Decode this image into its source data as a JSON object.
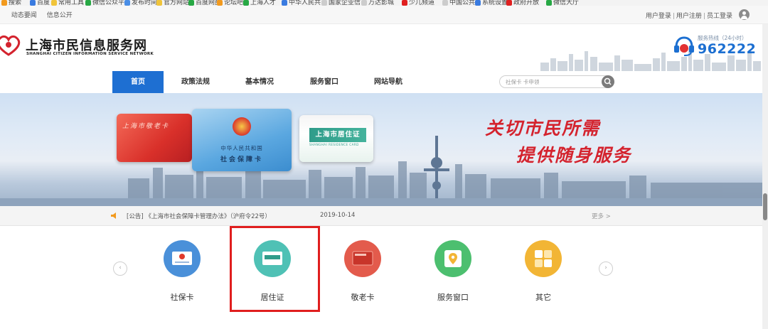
{
  "bookmarks": [
    "搜索",
    "百度",
    "常用工具",
    "微信公众平",
    "发布时间",
    "官方网站",
    "百度网盘",
    "论坛吧",
    "上海人才",
    "中华人民共",
    "国家企业信",
    "万达影城",
    "少儿频道",
    "中国公共",
    "系统设置",
    "政府开放",
    "微信大厅"
  ],
  "topbar": {
    "left_links": [
      "动态要闻",
      "信息公开"
    ],
    "login": "用户登录",
    "register": "用户注册",
    "staff_login": "员工登录",
    "separator": "|"
  },
  "header": {
    "site_name": "上海市民信息服务网",
    "site_name_en": "SHANGHAI CITIZEN INFORMATION SERVICE NETWORK",
    "hotline_label": "服务热线（24小时）",
    "hotline_number": "962222"
  },
  "nav": {
    "items": [
      "首页",
      "政策法规",
      "基本情况",
      "服务窗口",
      "网站导航"
    ],
    "active_index": 0
  },
  "search": {
    "placeholder": "社保卡 卡申领"
  },
  "banner": {
    "card_red_title": "上海市敬老卡",
    "card_blue_line1": "中华人民共和国",
    "card_blue_line2": "社会保障卡",
    "card_green_title": "上海市居住证",
    "card_green_sub": "SHANGHAI RESIDENCE CARD",
    "slogan_line1": "关切市民所需",
    "slogan_line2": "提供随身服务"
  },
  "notice": {
    "text": "[公告]  《上海市社会保障卡管理办法》（沪府令22号）",
    "date": "2019-10-14",
    "more": "更多 >"
  },
  "services": [
    {
      "label": "社保卡",
      "icon": "social-security-card-icon",
      "color": "#4a90d9"
    },
    {
      "label": "居住证",
      "icon": "residence-card-icon",
      "color": "#4fc1b5"
    },
    {
      "label": "敬老卡",
      "icon": "senior-card-icon",
      "color": "#e35b4c"
    },
    {
      "label": "服务窗口",
      "icon": "map-pin-icon",
      "color": "#4cbf6f"
    },
    {
      "label": "其它",
      "icon": "boxes-icon",
      "color": "#f2b535"
    }
  ],
  "colors": {
    "primary": "#1e6fd2",
    "accent_red": "#d4232e",
    "highlight": "#e01e1e"
  }
}
